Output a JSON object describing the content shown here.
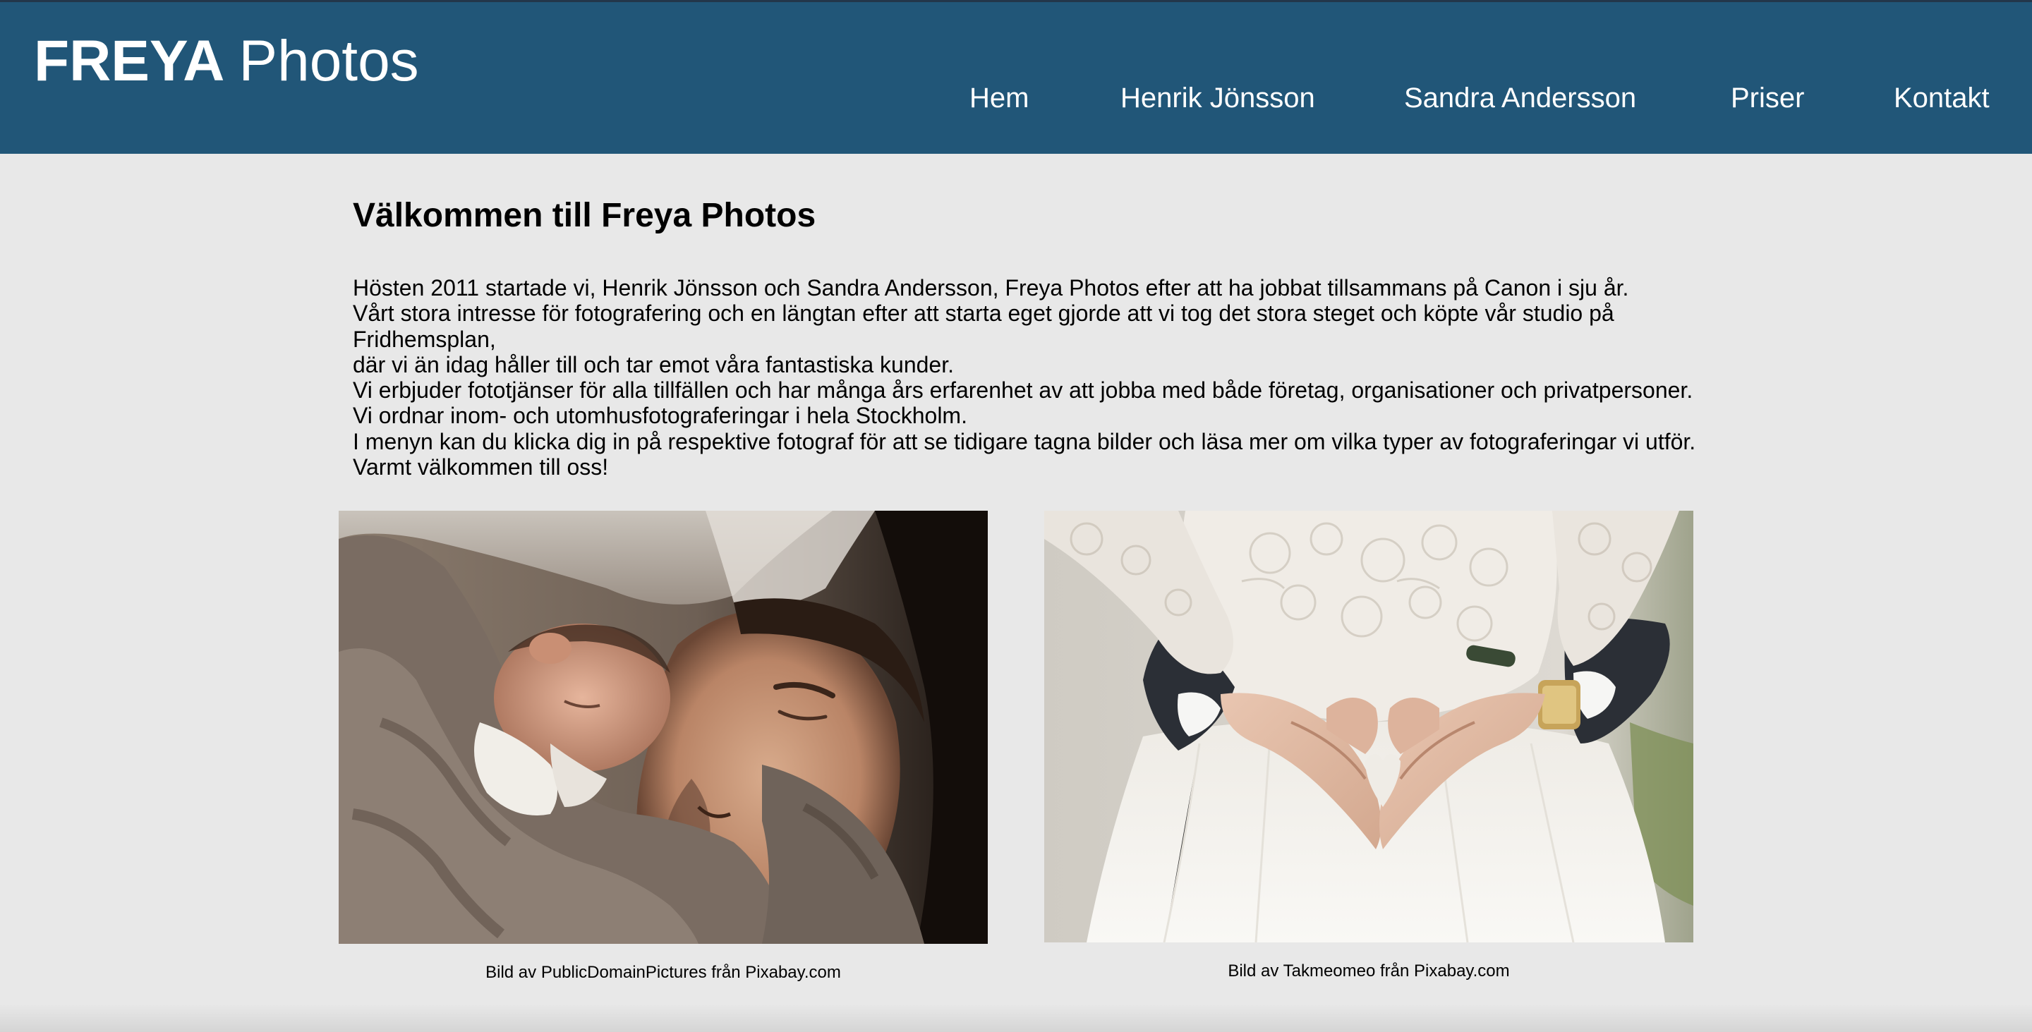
{
  "header": {
    "logo_bold": "FREYA",
    "logo_light": "Photos",
    "background_color": "#215678"
  },
  "nav": {
    "items": [
      "Hem",
      "Henrik Jönsson",
      "Sandra Andersson",
      "Priser",
      "Kontakt"
    ]
  },
  "main": {
    "title": "Välkommen till Freya Photos",
    "intro_lines": [
      "Hösten 2011 startade vi, Henrik Jönsson och Sandra Andersson, Freya Photos efter att ha jobbat tillsammans på Canon i sju år.",
      "Vårt stora intresse för fotografering och en längtan efter att starta eget gjorde att vi tog det stora steget och köpte vår studio på",
      "Fridhemsplan,",
      "där vi än idag håller till och tar emot våra fantastiska kunder.",
      "Vi erbjuder fototjänser för alla tillfällen och har många års erfarenhet av att jobba med både företag, organisationer och privatpersoner.",
      "Vi ordnar inom- och utomhusfotograferingar i hela Stockholm.",
      "I menyn kan du klicka dig in på respektive fotograf för att se tidigare tagna bilder och läsa mer om vilka typer av fotograferingar vi utför.",
      "Varmt välkommen till oss!"
    ]
  },
  "photos": [
    {
      "subject": "father-and-newborn-photo",
      "caption": "Bild av PublicDomainPictures från Pixabay.com"
    },
    {
      "subject": "wedding-heart-hands-photo",
      "caption": "Bild av Takmeomeo från Pixabay.com"
    }
  ]
}
